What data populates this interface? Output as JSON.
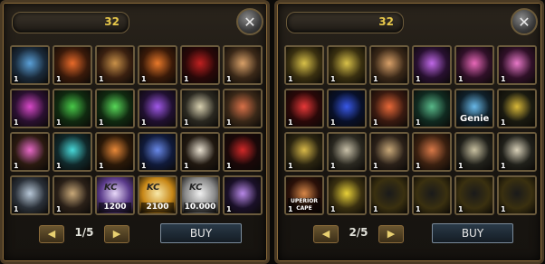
{
  "left_panel": {
    "gold": "32",
    "page": "1/5",
    "buy_label": "BUY",
    "items": [
      {
        "icon": "blue-gem-icon",
        "qty": "1",
        "bg": "#1a2a3a",
        "fg": "#5aa0d8"
      },
      {
        "icon": "fire-scroll-icon",
        "qty": "1",
        "bg": "#3a1a0a",
        "fg": "#e86a2a"
      },
      {
        "icon": "red-scroll-icon",
        "qty": "1",
        "bg": "#3a2010",
        "fg": "#c89048"
      },
      {
        "icon": "orange-swirl-icon",
        "qty": "1",
        "bg": "#3a1a08",
        "fg": "#e8782a"
      },
      {
        "icon": "red-crest-icon",
        "qty": "1",
        "bg": "#2a0808",
        "fg": "#c02020"
      },
      {
        "icon": "scroll-red-icon",
        "qty": "1",
        "bg": "#3a2818",
        "fg": "#d8a068"
      },
      {
        "icon": "pink-scroll-icon",
        "qty": "1",
        "bg": "#2a1030",
        "fg": "#d848c8"
      },
      {
        "icon": "green-scroll-icon",
        "qty": "1",
        "bg": "#102a10",
        "fg": "#48c848"
      },
      {
        "icon": "green-scroll-icon",
        "qty": "1",
        "bg": "#102a10",
        "fg": "#58d858"
      },
      {
        "icon": "purple-scroll-icon",
        "qty": "1",
        "bg": "#201030",
        "fg": "#a058e8"
      },
      {
        "icon": "skull-scroll-icon",
        "qty": "1",
        "bg": "#2a2820",
        "fg": "#d8d0b0"
      },
      {
        "icon": "red-rune-scroll-icon",
        "qty": "1",
        "bg": "#3a2818",
        "fg": "#d87048"
      },
      {
        "icon": "pink-potion-icon",
        "qty": "1",
        "bg": "#2a1a10",
        "fg": "#e868c8"
      },
      {
        "icon": "cyan-potion-icon",
        "qty": "1",
        "bg": "#10282a",
        "fg": "#48d8d8"
      },
      {
        "icon": "orange-medal-icon",
        "qty": "1",
        "bg": "#2a1808",
        "fg": "#e88838"
      },
      {
        "icon": "blue-star-medal-icon",
        "qty": "1",
        "bg": "#101a3a",
        "fg": "#6888e8"
      },
      {
        "icon": "white-crest-icon",
        "qty": "1",
        "bg": "#201810",
        "fg": "#e8e0d0"
      },
      {
        "icon": "red-demon-icon",
        "qty": "1",
        "bg": "#1a0808",
        "fg": "#d02828"
      },
      {
        "icon": "map-scroll-icon",
        "qty": "1",
        "bg": "#2a3038",
        "fg": "#b8c8d8"
      },
      {
        "icon": "dark-scroll-icon",
        "qty": "1",
        "bg": "#2a2018",
        "fg": "#c8a878"
      },
      {
        "icon": "kc-card-icon",
        "qty": "",
        "bg": "#5a3a8a",
        "fg": "#e8d8f8",
        "kc": "KC",
        "tag": "1200"
      },
      {
        "icon": "kc-card-icon",
        "qty": "",
        "bg": "#c88818",
        "fg": "#f8e8a8",
        "kc": "KC",
        "tag": "2100"
      },
      {
        "icon": "kc-card-icon",
        "qty": "",
        "bg": "#8a8a8a",
        "fg": "#f0f0f0",
        "kc": "KC",
        "tag": "10.000"
      },
      {
        "icon": "purple-emblem-icon",
        "qty": "1",
        "bg": "#1a1028",
        "fg": "#b888e8"
      }
    ]
  },
  "right_panel": {
    "gold": "32",
    "page": "2/5",
    "buy_label": "BUY",
    "items": [
      {
        "icon": "gold-scroll-icon",
        "qty": "1",
        "bg": "#3a3010",
        "fg": "#d8c048"
      },
      {
        "icon": "gold-scroll-icon",
        "qty": "1",
        "bg": "#3a3010",
        "fg": "#d8c048"
      },
      {
        "icon": "rune-scroll-icon",
        "qty": "1",
        "bg": "#3a2818",
        "fg": "#d8a068"
      },
      {
        "icon": "purple-scroll-icon",
        "qty": "1",
        "bg": "#281030",
        "fg": "#c068e8"
      },
      {
        "icon": "pink-scroll-icon",
        "qty": "1",
        "bg": "#301028",
        "fg": "#e868b8"
      },
      {
        "icon": "pink-scroll-icon",
        "qty": "1",
        "bg": "#301028",
        "fg": "#e878c8"
      },
      {
        "icon": "red-bottle-icon",
        "qty": "1",
        "bg": "#2a0808",
        "fg": "#e83838"
      },
      {
        "icon": "blue-bottle-icon",
        "qty": "1",
        "bg": "#08102a",
        "fg": "#3858e8"
      },
      {
        "icon": "red-hair-portrait-icon",
        "qty": "1",
        "bg": "#3a1a10",
        "fg": "#e86838"
      },
      {
        "icon": "green-elf-portrait-icon",
        "qty": "1",
        "bg": "#102a20",
        "fg": "#58b888"
      },
      {
        "icon": "genie-atom-icon",
        "qty": "",
        "bg": "#10202a",
        "fg": "#68b8e8",
        "genie": "Genie"
      },
      {
        "icon": "recycle-triangle-icon",
        "qty": "1",
        "bg": "#1a1a10",
        "fg": "#d8b838"
      },
      {
        "icon": "gold-armor-icon",
        "qty": "1",
        "bg": "#2a2410",
        "fg": "#d8b848"
      },
      {
        "icon": "silver-armor-icon",
        "qty": "1",
        "bg": "#2a2820",
        "fg": "#c8c0a8"
      },
      {
        "icon": "dark-scroll-icon",
        "qty": "1",
        "bg": "#2a2018",
        "fg": "#c8a878"
      },
      {
        "icon": "red-scroll-icon",
        "qty": "1",
        "bg": "#3a2010",
        "fg": "#d87848"
      },
      {
        "icon": "warrior-icon",
        "qty": "1",
        "bg": "#20201a",
        "fg": "#c8c0a0"
      },
      {
        "icon": "knight-icon",
        "qty": "1",
        "bg": "#20201a",
        "fg": "#d8d0b8"
      },
      {
        "icon": "superior-cape-icon",
        "qty": "1",
        "bg": "#2a1008",
        "fg": "#d88848",
        "tag": "UPERIOR CAPE"
      },
      {
        "icon": "yellow-swap-scroll-icon",
        "qty": "1",
        "bg": "#3a3010",
        "fg": "#e8d038"
      },
      {
        "icon": "sun-scroll-icon",
        "qty": "1",
        "bg": "#3a3010",
        "fg": "#1a1a1a"
      },
      {
        "icon": "moon-scroll-icon",
        "qty": "1",
        "bg": "#3a3010",
        "fg": "#1a1a1a"
      },
      {
        "icon": "star-scroll-icon",
        "qty": "1",
        "bg": "#3a3010",
        "fg": "#1a1a1a"
      },
      {
        "icon": "beast-scroll-icon",
        "qty": "1",
        "bg": "#3a3010",
        "fg": "#1a1a1a"
      }
    ]
  },
  "icons": {
    "close": "close-icon",
    "prev": "arrow-left-icon",
    "next": "arrow-right-icon",
    "close_glyph": "✕",
    "prev_glyph": "◀",
    "next_glyph": "▶"
  }
}
